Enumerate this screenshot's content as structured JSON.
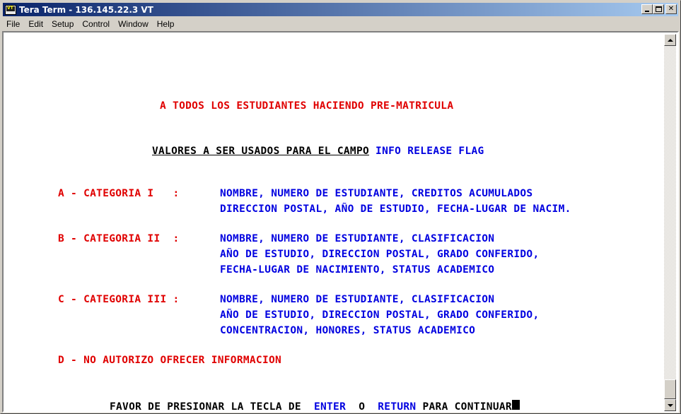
{
  "window": {
    "title": "Tera Term - 136.145.22.3 VT",
    "icon_label": "VT",
    "icon": "teraterm-app-icon"
  },
  "menu": [
    {
      "label": "File"
    },
    {
      "label": "Edit"
    },
    {
      "label": "Setup"
    },
    {
      "label": "Control"
    },
    {
      "label": "Window"
    },
    {
      "label": "Help"
    }
  ],
  "colors": {
    "red_text": "#e00000",
    "blue_text": "#0000e0",
    "title_gradient_start": "#0a246a",
    "title_gradient_end": "#a6caf0"
  },
  "terminal": {
    "header": "A TODOS LOS ESTUDIANTES HACIENDO PRE-MATRICULA",
    "subheader_underlined": "VALORES A SER USADOS PARA EL CAMPO",
    "subheader_field": "INFO RELEASE FLAG",
    "categories": [
      {
        "code": "A - CATEGORIA I   :",
        "lines": [
          "NOMBRE, NUMERO DE ESTUDIANTE, CREDITOS ACUMULADOS",
          "DIRECCION POSTAL, AÑO DE ESTUDIO, FECHA-LUGAR DE NACIM."
        ]
      },
      {
        "code": "B - CATEGORIA II  :",
        "lines": [
          "NOMBRE, NUMERO DE ESTUDIANTE, CLASIFICACION",
          "AÑO DE ESTUDIO, DIRECCION POSTAL, GRADO CONFERIDO,",
          "FECHA-LUGAR DE NACIMIENTO, STATUS ACADEMICO"
        ]
      },
      {
        "code": "C - CATEGORIA III :",
        "lines": [
          "NOMBRE, NUMERO DE ESTUDIANTE, CLASIFICACION",
          "AÑO DE ESTUDIO, DIRECCION POSTAL, GRADO CONFERIDO,",
          "CONCENTRACION, HONORES, STATUS ACADEMICO"
        ]
      }
    ],
    "option_d": "D - NO AUTORIZO OFRECER INFORMACION",
    "prompt": {
      "part1": "FAVOR DE PRESIONAR LA TECLA DE",
      "enter": "ENTER",
      "o": "O",
      "return": "RETURN",
      "part2": "PARA CONTINUAR"
    }
  }
}
